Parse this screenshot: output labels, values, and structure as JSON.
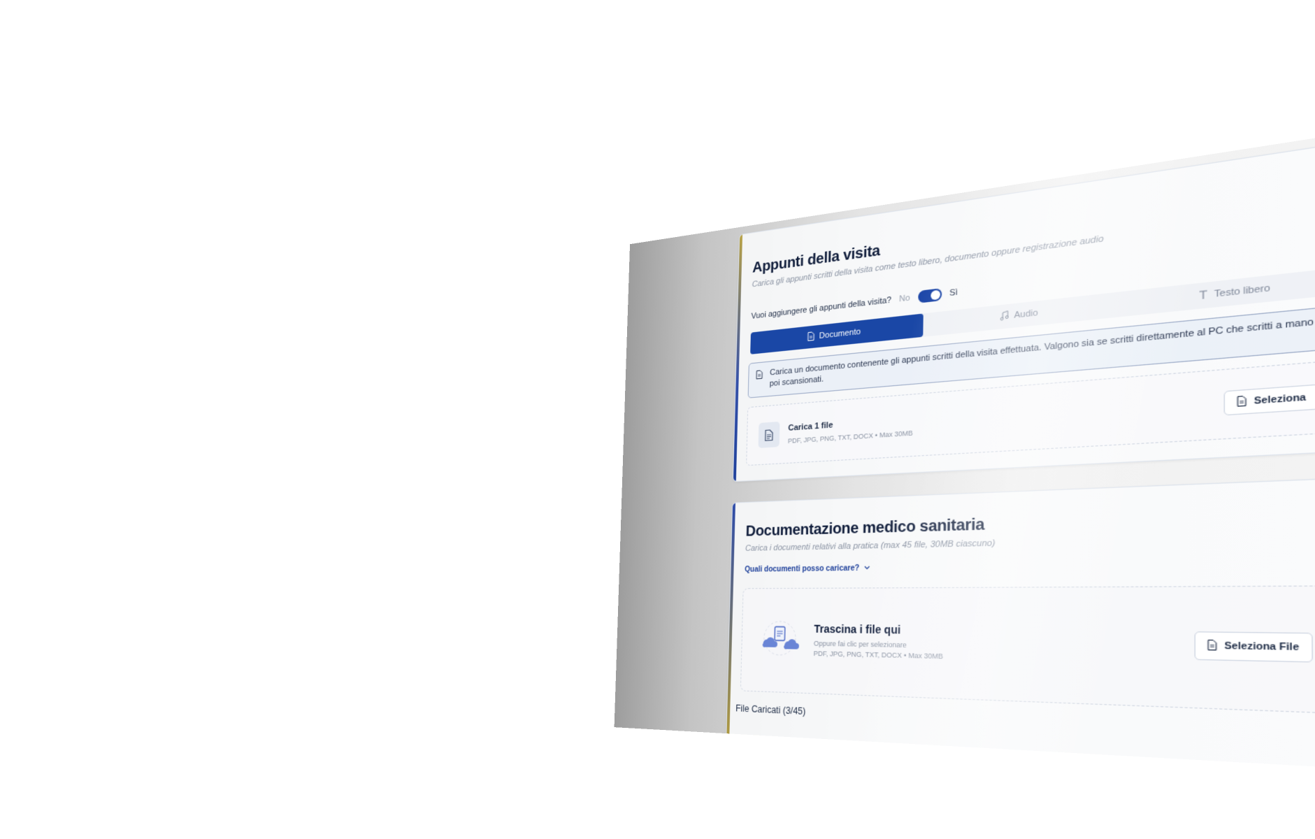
{
  "visit_notes": {
    "title": "Appunti della visita",
    "subtitle": "Carica gli appunti scritti della visita come testo libero, documento oppure registrazione audio",
    "toggle_question": "Vuoi aggiungere gli appunti della visita?",
    "toggle_no": "No",
    "toggle_yes": "Sì",
    "toggle_state": "on",
    "tabs": [
      {
        "label": "Documento",
        "icon": "document-icon",
        "active": true
      },
      {
        "label": "Audio",
        "icon": "music-note-icon",
        "active": false
      },
      {
        "label": "Testo libero",
        "icon": "text-icon",
        "active": false
      }
    ],
    "info_text": "Carica un documento contenente gli appunti scritti della visita effettuata. Valgono sia se scritti direttamente al PC che scritti a mano e poi scansionati.",
    "upload_label": "Carica 1 file",
    "upload_formats": "PDF, JPG, PNG, TXT, DOCX • Max 30MB",
    "select_button": "Seleziona"
  },
  "medical_docs": {
    "title": "Documentazione medico sanitaria",
    "subtitle": "Carica i documenti relativi alla pratica (max 45 file, 30MB ciascuno)",
    "help_link": "Quali documenti posso caricare?",
    "drop_title": "Trascina i file qui",
    "drop_sub": "Oppure fai clic per selezionare",
    "drop_formats": "PDF, JPG, PNG, TXT, DOCX • Max 30MB",
    "select_files_button": "Seleziona File",
    "files_uploaded": "File Caricati (3/45)"
  },
  "colors": {
    "primary": "#1a47a6",
    "accent_gold": "#b8a144",
    "text_dark": "#0f1c3a"
  }
}
